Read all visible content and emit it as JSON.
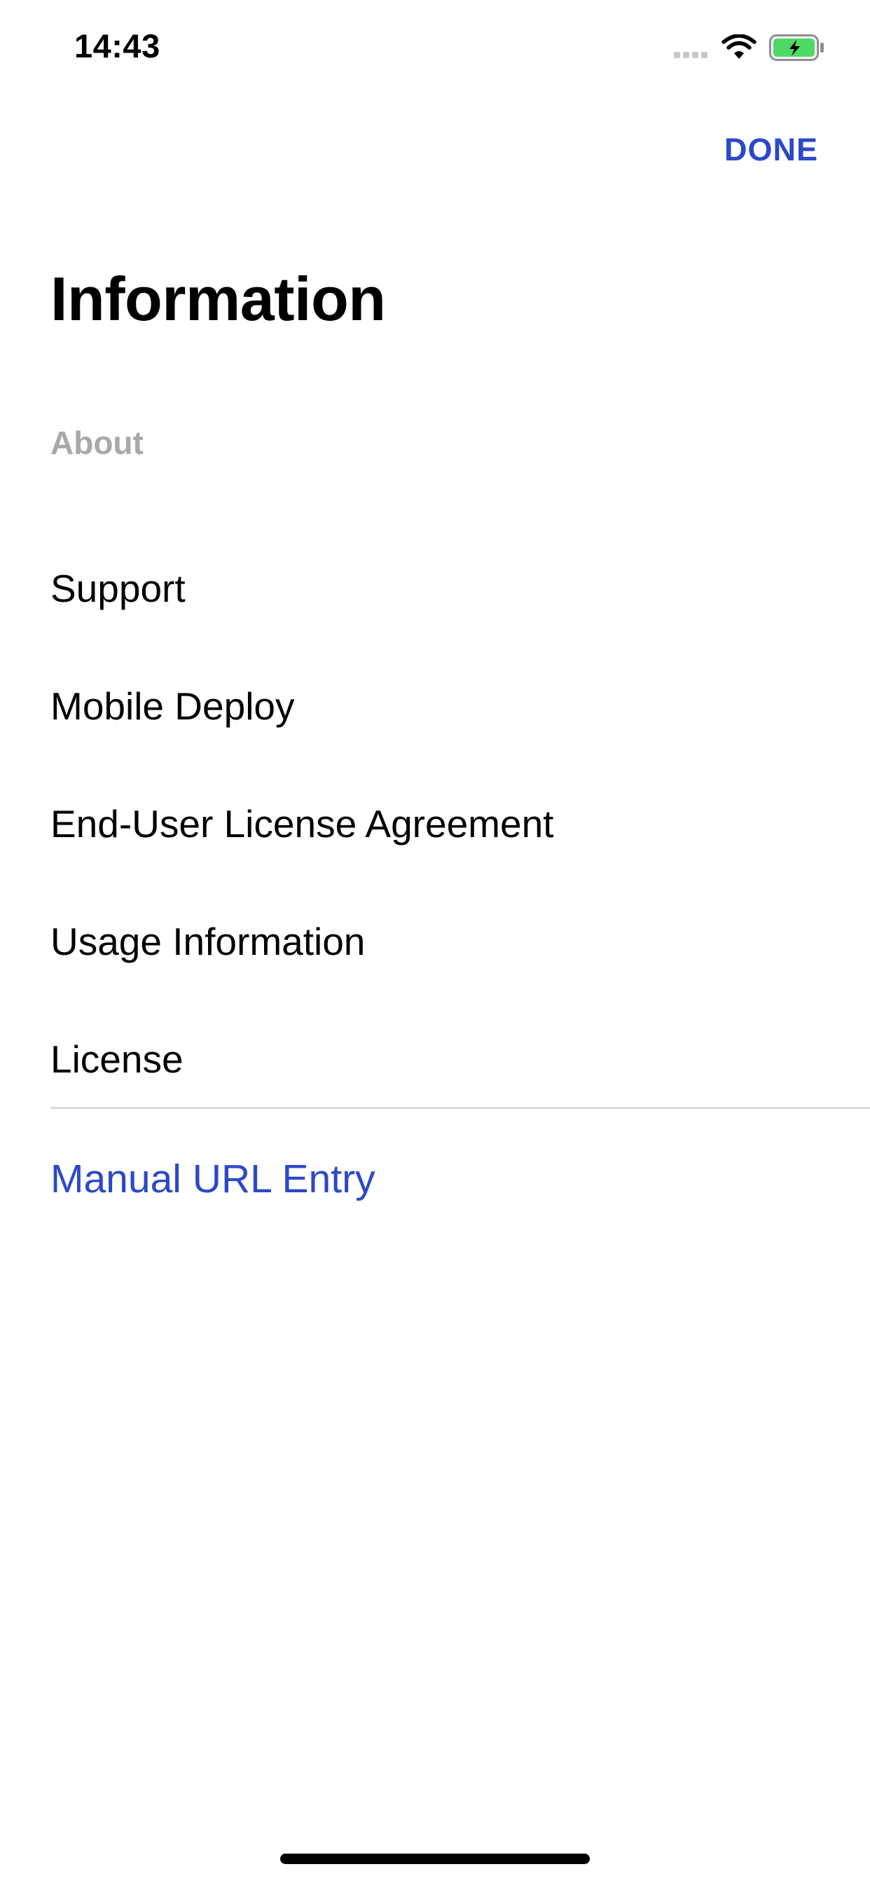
{
  "status_bar": {
    "time": "14:43",
    "icons": [
      "signal-icon",
      "wifi-icon",
      "battery-charging-icon"
    ]
  },
  "header": {
    "done_label": "DONE"
  },
  "page": {
    "title": "Information",
    "section_header": "About"
  },
  "menu": {
    "items": [
      {
        "label": "Support"
      },
      {
        "label": "Mobile Deploy"
      },
      {
        "label": "End-User License Agreement"
      },
      {
        "label": "Usage Information"
      },
      {
        "label": "License"
      }
    ]
  },
  "links": {
    "manual_url_entry": "Manual URL Entry"
  },
  "colors": {
    "accent": "#2d48c8",
    "section_header": "#a8a8ad",
    "battery_fill": "#4cd964",
    "divider": "#dcdcdf"
  }
}
